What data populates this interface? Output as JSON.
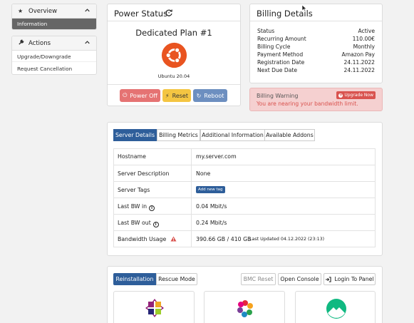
{
  "sidebar": {
    "overview": {
      "title": "Overview",
      "items": [
        "Information"
      ]
    },
    "actions": {
      "title": "Actions",
      "items": [
        "Upgrade/Downgrade",
        "Request Cancellation"
      ]
    }
  },
  "power": {
    "title": "Power Status:",
    "plan": "Dedicated Plan #1",
    "os": "Ubuntu 20.04",
    "buttons": {
      "off": "Power Off",
      "reset": "Reset",
      "reboot": "Reboot"
    },
    "colors": {
      "off": "#e57373",
      "reset": "#f4c542",
      "reboot": "#6d8fc0"
    }
  },
  "billing": {
    "title": "Billing Details",
    "rows": [
      {
        "label": "Status",
        "value": "Active"
      },
      {
        "label": "Recurring Amount",
        "value": "110.00€"
      },
      {
        "label": "Billing Cycle",
        "value": "Monthly"
      },
      {
        "label": "Payment Method",
        "value": "Amazon Pay"
      },
      {
        "label": "Registration Date",
        "value": "24.11.2022"
      },
      {
        "label": "Next Due Date",
        "value": "24.11.2022"
      }
    ]
  },
  "warning": {
    "title": "Billing Warning",
    "message": "You are nearing your bandwidth limit.",
    "button": "Upgrade Now",
    "accent": "#d9534f"
  },
  "details": {
    "tabs": [
      "Server Details",
      "Billing Metrics",
      "Additional Information",
      "Available Addons"
    ],
    "rows": {
      "hostname": {
        "label": "Hostname",
        "value": "my.server.com"
      },
      "description": {
        "label": "Server Description",
        "value": "None"
      },
      "tags": {
        "label": "Server Tags",
        "button": "Add new tag"
      },
      "bw_in": {
        "label": "Last BW in",
        "value": "0.04 Mbit/s"
      },
      "bw_out": {
        "label": "Last BW out",
        "value": "0.24 Mbit/s"
      },
      "usage": {
        "label": "Bandwidth Usage",
        "value": "390.66 GB / 410 GB",
        "updated": "Last Updated 04.12.2022 (23:13)"
      }
    }
  },
  "reinstall": {
    "tabs": [
      "Reinstallation",
      "Rescue Mode"
    ],
    "buttons": {
      "bmc": "BMC Reset",
      "console": "Open Console",
      "login": "Login To Panel"
    }
  }
}
